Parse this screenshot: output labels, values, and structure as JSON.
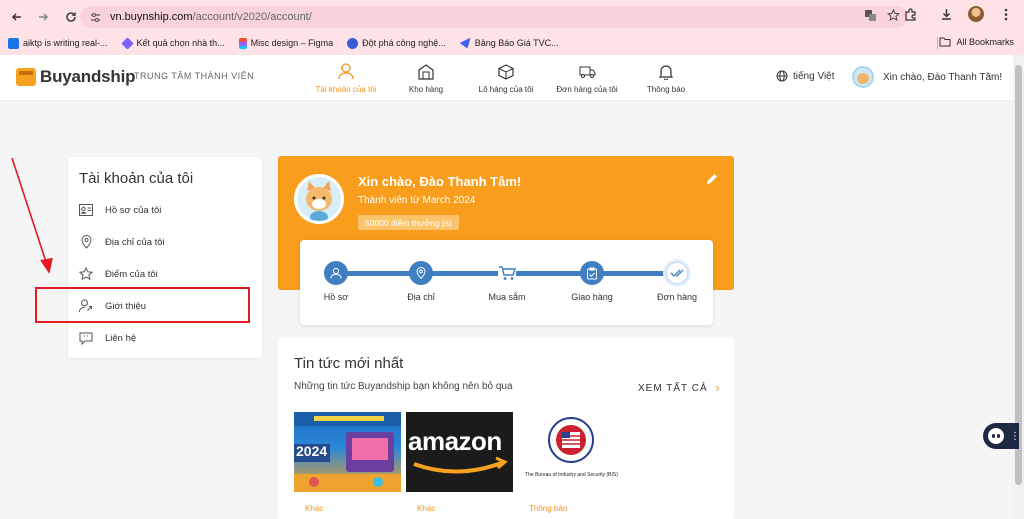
{
  "browser": {
    "url_host": "vn.buynship.com",
    "url_path": "/account/v2020/account/",
    "bookmarks": [
      {
        "label": "aiktp is writing real-...",
        "color": "#1a73e8"
      },
      {
        "label": "Kết quả chọn nhà th...",
        "color": "#7b61ff"
      },
      {
        "label": "Misc design – Figma",
        "color": "#f24e1e"
      },
      {
        "label": "Đột phá công nghệ...",
        "color": "#3b5bdb"
      },
      {
        "label": "Bảng Báo Giá TVC...",
        "color": "#4263eb"
      }
    ],
    "all_bookmarks": "All Bookmarks"
  },
  "header": {
    "brand": "Buyandship",
    "subtitle": "TRUNG TÂM THÀNH VIÊN",
    "nav": [
      {
        "label": "Tài khoản của tôi",
        "icon": "user-icon",
        "active": true
      },
      {
        "label": "Kho hàng",
        "icon": "warehouse-icon",
        "active": false
      },
      {
        "label": "Lô hàng của tôi",
        "icon": "box-icon",
        "active": false
      },
      {
        "label": "Đơn hàng của tôi",
        "icon": "truck-icon",
        "active": false
      },
      {
        "label": "Thông báo",
        "icon": "bell-icon",
        "active": false
      }
    ],
    "language": "tiếng Việt",
    "greeting": "Xin chào, Đào Thanh Tâm!"
  },
  "sidebar": {
    "title": "Tài khoản của tôi",
    "items": [
      {
        "label": "Hồ sơ của tôi",
        "icon": "id-card-icon"
      },
      {
        "label": "Địa chỉ của tôi",
        "icon": "location-pin-icon"
      },
      {
        "label": "Điểm của tôi",
        "icon": "star-icon"
      },
      {
        "label": "Giới thiệu",
        "icon": "user-share-icon"
      },
      {
        "label": "Liên hệ",
        "icon": "chat-icon"
      }
    ]
  },
  "profile": {
    "greeting": "Xin chào, Đào Thanh Tâm!",
    "member_since": "Thành viên từ March 2024",
    "points": "50000 điểm thưởng (s)",
    "steps": [
      {
        "label": "Hồ sơ",
        "icon": "user-icon"
      },
      {
        "label": "Địa chỉ",
        "icon": "location-pin-icon"
      },
      {
        "label": "Mua sắm",
        "icon": "cart-icon"
      },
      {
        "label": "Giao hàng",
        "icon": "clipboard-check-icon"
      },
      {
        "label": "Đơn hàng",
        "icon": "double-check-icon"
      }
    ]
  },
  "news": {
    "title": "Tin tức mới nhất",
    "subtitle": "Những tin tức Buyandship bạn không nên bỏ qua",
    "see_all": "XEM TẤT CẢ",
    "items": [
      {
        "category": "Khác",
        "thumb_text": "2024"
      },
      {
        "category": "Khác",
        "thumb_text": "amazon"
      },
      {
        "category": "Thông báo",
        "thumb_text": "The Bureau of Industry and Security (BIS)"
      }
    ]
  },
  "colors": {
    "brand_orange": "#f99d1c",
    "step_blue": "#3e7ec1",
    "annotation_red": "#e31b23"
  }
}
